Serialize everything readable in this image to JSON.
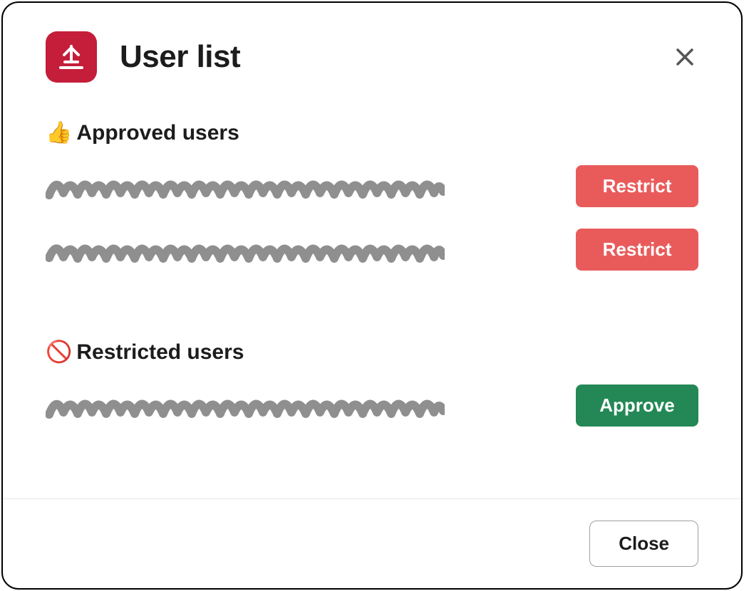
{
  "header": {
    "title": "User list",
    "app_icon_name": "app-logo-icon"
  },
  "sections": {
    "approved": {
      "emoji": "👍",
      "title": "Approved users",
      "action_label": "Restrict",
      "rows": 2
    },
    "restricted": {
      "emoji": "🚫",
      "title": "Restricted users",
      "action_label": "Approve",
      "rows": 1
    }
  },
  "footer": {
    "close_label": "Close"
  },
  "colors": {
    "restrict": "#e95b5b",
    "approve": "#238855",
    "app_icon_bg": "#c41e3a"
  }
}
